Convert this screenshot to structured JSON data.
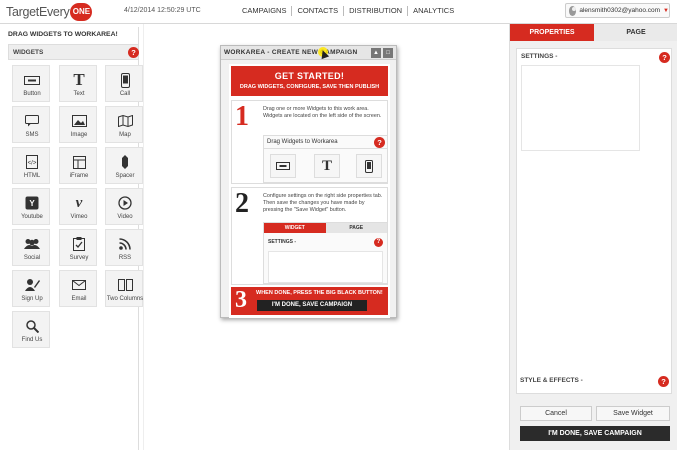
{
  "header": {
    "logo_text": "TargetEvery",
    "logo_badge": "ONE",
    "timestamp": "4/12/2014 12:50:29 UTC",
    "nav": [
      "CAMPAIGNS",
      "CONTACTS",
      "DISTRIBUTION",
      "ANALYTICS"
    ],
    "user_email": "alensmith0302@yahoo.com"
  },
  "left": {
    "title": "DRAG WIDGETS TO WORKAREA!",
    "widgets_header": "WIDGETS",
    "help": "?",
    "widgets": [
      {
        "label": "Button",
        "icon": "button-icon"
      },
      {
        "label": "Text",
        "icon": "text-icon"
      },
      {
        "label": "Call",
        "icon": "phone-icon"
      },
      {
        "label": "SMS",
        "icon": "sms-icon"
      },
      {
        "label": "Image",
        "icon": "image-icon"
      },
      {
        "label": "Map",
        "icon": "map-icon"
      },
      {
        "label": "HTML",
        "icon": "html-icon"
      },
      {
        "label": "iFrame",
        "icon": "iframe-icon"
      },
      {
        "label": "Spacer",
        "icon": "spacer-icon"
      },
      {
        "label": "Youtube",
        "icon": "youtube-icon"
      },
      {
        "label": "Vimeo",
        "icon": "vimeo-icon"
      },
      {
        "label": "Video",
        "icon": "video-icon"
      },
      {
        "label": "Social",
        "icon": "social-icon"
      },
      {
        "label": "Survey",
        "icon": "survey-icon"
      },
      {
        "label": "RSS",
        "icon": "rss-icon"
      },
      {
        "label": "Sign Up",
        "icon": "signup-icon"
      },
      {
        "label": "Email",
        "icon": "email-icon"
      },
      {
        "label": "Two Columns",
        "icon": "two-columns-icon"
      },
      {
        "label": "Find Us",
        "icon": "find-us-icon"
      }
    ]
  },
  "workarea": {
    "title": "WORKAREA - CREATE NEW CAMPAIGN",
    "get_started": "GET STARTED!",
    "get_started_sub": "DRAG WIDGETS, CONFIGURE, SAVE THEN PUBLISH",
    "step1_num": "1",
    "step1_text": "Drag one or more Widgets to this work area. Widgets are located on the left side of the screen.",
    "step1_panel_title": "Drag Widgets to Workarea",
    "step1_button_text": "BTN",
    "step1_text_icon": "T",
    "step2_num": "2",
    "step2_text": "Configure settings on the right side properties tab. Then save the changes you have made by pressing the \"Save Widget\" button.",
    "step2_tab_widget": "WIDGET",
    "step2_tab_page": "PAGE",
    "step2_settings": "SETTINGS -",
    "step3_num": "3",
    "step3_text": "WHEN DONE, PRESS THE BIG BLACK BUTTON!",
    "step3_button": "I'M DONE, SAVE CAMPAIGN"
  },
  "right": {
    "tab_properties": "PROPERTIES",
    "tab_page": "PAGE",
    "settings": "SETTINGS -",
    "style_effects": "STYLE & EFFECTS -",
    "cancel": "Cancel",
    "save_widget": "Save Widget",
    "done": "I'M DONE, SAVE CAMPAIGN"
  },
  "colors": {
    "accent": "#d62b20",
    "dark_button": "#2b2b2b"
  }
}
